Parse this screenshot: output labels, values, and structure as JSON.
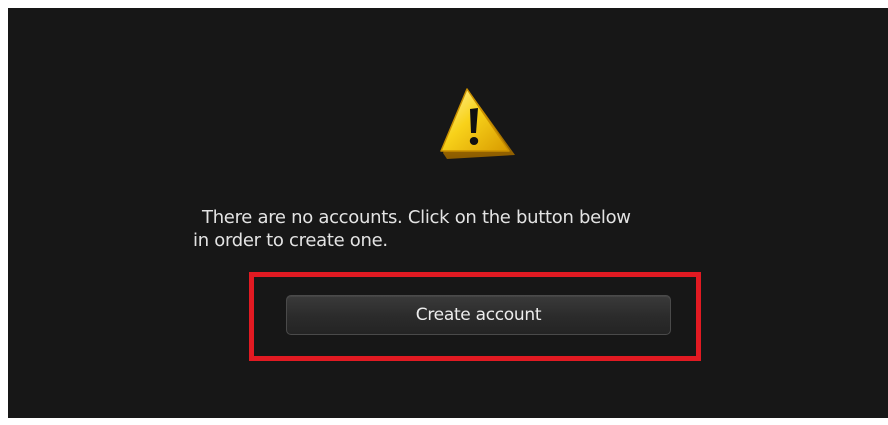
{
  "notice": {
    "icon": "warning-icon",
    "message_line1": "There are no accounts. Click on the button below",
    "message_line2": "in order to create one."
  },
  "actions": {
    "create_account_label": "Create account"
  },
  "colors": {
    "background": "#171717",
    "text": "#e3e3e3",
    "highlight": "#e11a22",
    "warning": "#f2c500"
  }
}
